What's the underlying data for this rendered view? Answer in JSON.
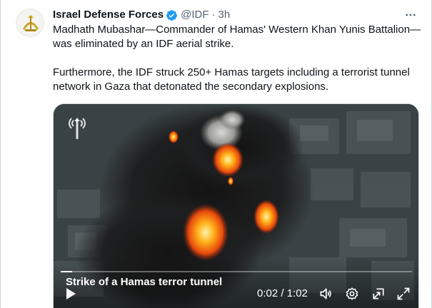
{
  "post": {
    "author_name": "Israel Defense Forces",
    "handle": "@IDF",
    "separator": "·",
    "time": "3h",
    "paragraphs": [
      "Madhath Mubashar—Commander of Hamas' Western Khan Yunis Battalion—was eliminated by an IDF aerial strike.",
      "Furthermore, the IDF struck 250+ Hamas targets including a terrorist tunnel network in Gaza that detonated the secondary explosions."
    ]
  },
  "video": {
    "title": "Strike of a Hamas terror tunnel",
    "time_display": "0:02 / 1:02",
    "progress": 0.032
  },
  "icons": {
    "avatar": "idf-emblem-icon",
    "verified": "verified-badge-icon",
    "more": "more-icon",
    "watermark": "idf-spokesperson-icon",
    "play": "play-icon",
    "volume": "volume-icon",
    "settings": "settings-icon",
    "pop_out": "pop-out-icon",
    "fullscreen": "fullscreen-icon"
  },
  "colors": {
    "verified": "#1d9bf0",
    "text_primary": "#0f1419",
    "text_secondary": "#536471",
    "fire": "#ff8a00"
  }
}
